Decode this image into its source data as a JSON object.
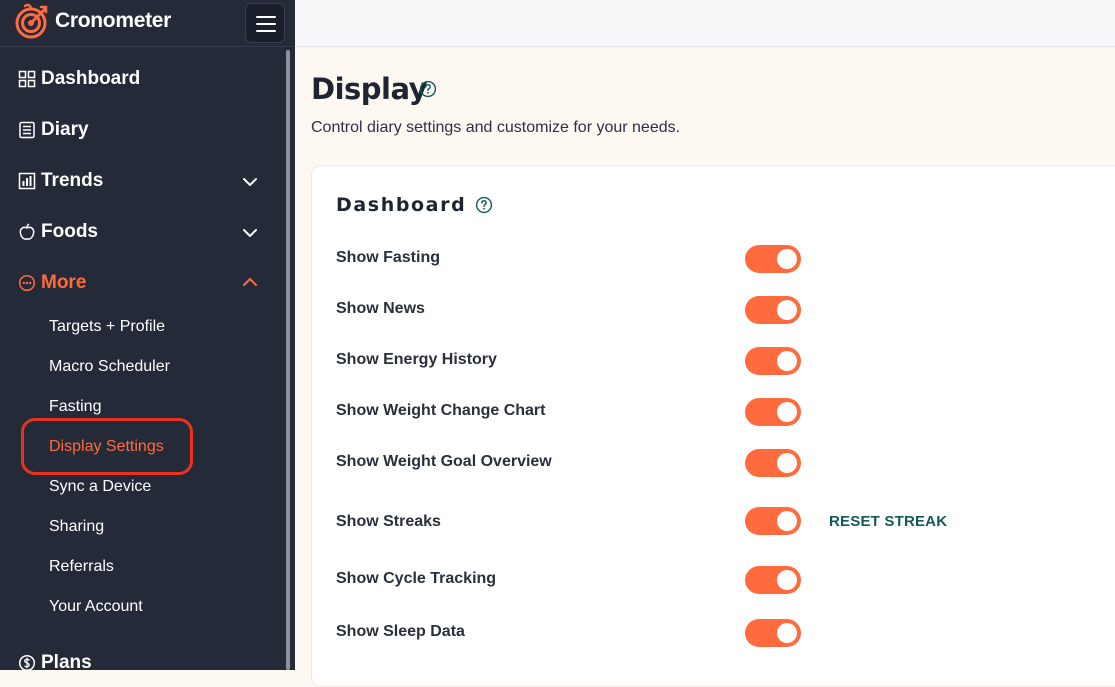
{
  "app": {
    "name": "Cronometer"
  },
  "sidebar": {
    "nav": [
      {
        "label": "Dashboard",
        "icon": "dashboard-grid-icon"
      },
      {
        "label": "Diary",
        "icon": "diary-list-icon"
      },
      {
        "label": "Trends",
        "icon": "bar-chart-icon",
        "expandable": true,
        "expanded": false
      },
      {
        "label": "Foods",
        "icon": "apple-icon",
        "expandable": true,
        "expanded": false
      },
      {
        "label": "More",
        "icon": "more-dots-icon",
        "expandable": true,
        "expanded": true
      },
      {
        "label": "Plans",
        "icon": "dollar-icon"
      }
    ],
    "more_items": [
      {
        "label": "Targets + Profile"
      },
      {
        "label": "Macro Scheduler"
      },
      {
        "label": "Fasting"
      },
      {
        "label": "Display Settings",
        "active": true
      },
      {
        "label": "Sync a Device"
      },
      {
        "label": "Sharing"
      },
      {
        "label": "Referrals"
      },
      {
        "label": "Your Account"
      }
    ]
  },
  "page": {
    "title": "Display",
    "subtitle": "Control diary settings and customize for your needs."
  },
  "card": {
    "title": "Dashboard",
    "settings": [
      {
        "label": "Show Fasting",
        "enabled": true
      },
      {
        "label": "Show News",
        "enabled": true
      },
      {
        "label": "Show Energy History",
        "enabled": true
      },
      {
        "label": "Show Weight Change Chart",
        "enabled": true
      },
      {
        "label": "Show Weight Goal Overview",
        "enabled": true
      },
      {
        "label": "Show Streaks",
        "enabled": true,
        "action": "RESET STREAK"
      },
      {
        "label": "Show Cycle Tracking",
        "enabled": true
      },
      {
        "label": "Show Sleep Data",
        "enabled": true
      }
    ]
  },
  "colors": {
    "sidebar_bg": "#252a39",
    "accent": "#ff6b3d",
    "highlight_ring": "#e8331f",
    "link_teal": "#14595c",
    "page_bg": "#fdf8f1"
  }
}
